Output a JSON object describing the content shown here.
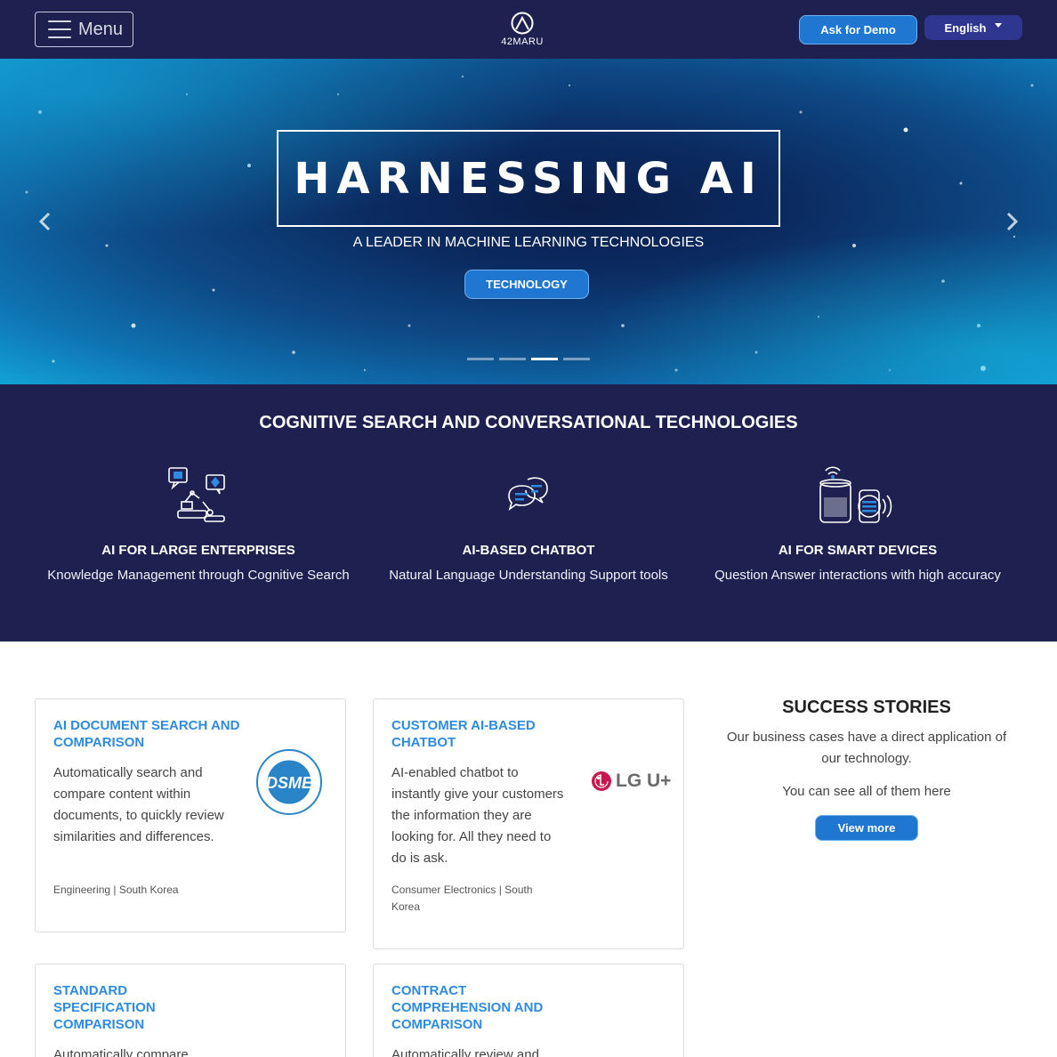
{
  "nav": {
    "menu_label": "Menu",
    "logo_text": "42MARU",
    "demo_label": "Ask for Demo",
    "language_label": "English"
  },
  "hero": {
    "title": "HARNESSING AI",
    "subtitle": "A LEADER IN MACHINE LEARNING TECHNOLOGIES",
    "button_label": "TECHNOLOGY",
    "slide_count": 4,
    "active_slide": 3
  },
  "features": {
    "heading": "COGNITIVE SEARCH AND CONVERSATIONAL TECHNOLOGIES",
    "items": [
      {
        "title": "AI FOR LARGE ENTERPRISES",
        "description": "Knowledge Management through Cognitive Search",
        "icon": "enterprise-robot-icon"
      },
      {
        "title": "AI-BASED CHATBOT",
        "description": "Natural Language Understanding Support tools",
        "icon": "chat-bubbles-icon"
      },
      {
        "title": "AI FOR SMART DEVICES",
        "description": "Question Answer interactions with high accuracy",
        "icon": "smart-devices-icon"
      }
    ]
  },
  "cards": [
    {
      "title": "AI DOCUMENT SEARCH AND COMPARISON",
      "description": "Automatically search and compare content within documents, to quickly review similarities and differences.",
      "meta": "Engineering | South Korea",
      "logo": "DSME"
    },
    {
      "title": "CUSTOMER AI-BASED CHATBOT",
      "description": "AI-enabled chatbot to instantly give your customers the information they are looking for. All they need to do is ask.",
      "meta": "Consumer Electronics | South Korea",
      "logo": "LG U+"
    },
    {
      "title": "STANDARD SPECIFICATION COMPARISON",
      "description": "Automatically compare"
    },
    {
      "title": "CONTRACT COMPREHENSION AND COMPARISON",
      "description": "Automatically review and"
    }
  ],
  "stories": {
    "heading": "SUCCESS STORIES",
    "description": "Our business cases have a direct application of our technology.",
    "note": "You can see all of them here",
    "button_label": "View more"
  },
  "colors": {
    "navy": "#1e2150",
    "accent_blue": "#1f77d2",
    "card_title_blue": "#2f8be0",
    "lg_red": "#c8174e"
  }
}
